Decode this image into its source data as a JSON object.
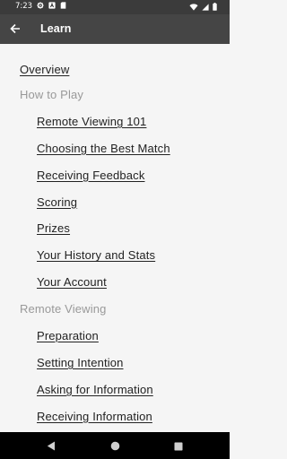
{
  "status_bar": {
    "time": "7:23",
    "left_icons": [
      "gear-icon",
      "notification-a-icon",
      "sd-card-icon"
    ],
    "right_icons": [
      "wifi-icon",
      "cellular-icon",
      "battery-icon"
    ]
  },
  "app_bar": {
    "back_icon": "arrow-left-icon",
    "title": "Learn"
  },
  "menu": [
    {
      "type": "link",
      "level": 0,
      "label": "Overview"
    },
    {
      "type": "section",
      "level": 0,
      "label": "How to Play"
    },
    {
      "type": "link",
      "level": 1,
      "label": "Remote Viewing 101"
    },
    {
      "type": "link",
      "level": 1,
      "label": "Choosing the Best Match"
    },
    {
      "type": "link",
      "level": 1,
      "label": "Receiving Feedback"
    },
    {
      "type": "link",
      "level": 1,
      "label": "Scoring"
    },
    {
      "type": "link",
      "level": 1,
      "label": "Prizes"
    },
    {
      "type": "link",
      "level": 1,
      "label": "Your History and Stats"
    },
    {
      "type": "link",
      "level": 1,
      "label": "Your Account"
    },
    {
      "type": "section",
      "level": 0,
      "label": "Remote Viewing"
    },
    {
      "type": "link",
      "level": 1,
      "label": "Preparation"
    },
    {
      "type": "link",
      "level": 1,
      "label": "Setting Intention"
    },
    {
      "type": "link",
      "level": 1,
      "label": "Asking for Information"
    },
    {
      "type": "link",
      "level": 1,
      "label": "Receiving Information"
    }
  ],
  "nav_bar": {
    "back_icon": "triangle-back-icon",
    "home_icon": "circle-home-icon",
    "recents_icon": "square-recents-icon"
  },
  "colors": {
    "status_bar_bg": "#3b3b3b",
    "app_bar_bg": "#454545",
    "page_bg": "#f5f5f5",
    "link_text": "#222222",
    "section_text": "#999999",
    "nav_bar_bg": "#000000"
  }
}
